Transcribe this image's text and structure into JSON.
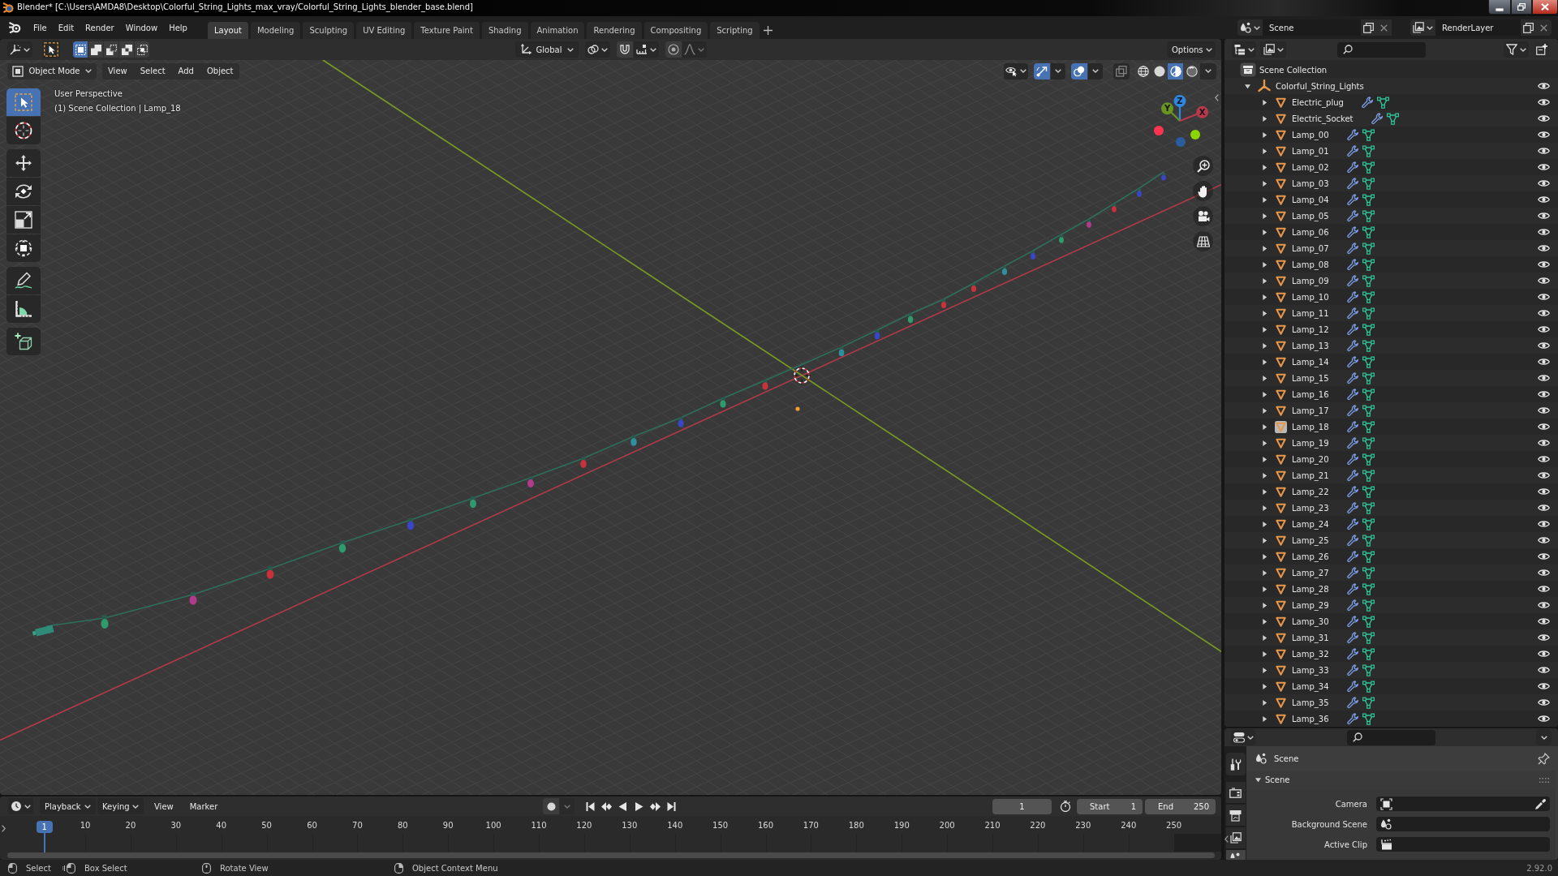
{
  "window": {
    "title": "Blender* [C:\\Users\\AMDA8\\Desktop\\Colorful_String_Lights_max_vray/Colorful_String_Lights_blender_base.blend]"
  },
  "top_bar": {
    "menus": [
      "File",
      "Edit",
      "Render",
      "Window",
      "Help"
    ],
    "workspaces": [
      {
        "label": "Layout",
        "selected": true
      },
      {
        "label": "Modeling",
        "selected": false
      },
      {
        "label": "Sculpting",
        "selected": false
      },
      {
        "label": "UV Editing",
        "selected": false
      },
      {
        "label": "Texture Paint",
        "selected": false
      },
      {
        "label": "Shading",
        "selected": false
      },
      {
        "label": "Animation",
        "selected": false
      },
      {
        "label": "Rendering",
        "selected": false
      },
      {
        "label": "Compositing",
        "selected": false
      },
      {
        "label": "Scripting",
        "selected": false
      }
    ],
    "scene": "Scene",
    "view_layer": "RenderLayer"
  },
  "viewport": {
    "tool_header": {
      "select_modes": [
        {
          "kind": "set",
          "selected": true
        },
        {
          "kind": "extend",
          "selected": false
        },
        {
          "kind": "subtract",
          "selected": false
        },
        {
          "kind": "difference",
          "selected": false
        },
        {
          "kind": "intersect",
          "selected": false
        }
      ],
      "orientation": "Global",
      "snap_on": false,
      "proportional_on": false,
      "options": "Options"
    },
    "header": {
      "mode": "Object Mode",
      "menus": [
        "View",
        "Select",
        "Add",
        "Object"
      ],
      "gizmos_on": true,
      "overlays_on": true,
      "xray_on": false,
      "shading": [
        {
          "kind": "wireframe",
          "selected": false
        },
        {
          "kind": "solid",
          "selected": false
        },
        {
          "kind": "material",
          "selected": true
        },
        {
          "kind": "rendered",
          "selected": false
        }
      ]
    },
    "tools": [
      {
        "kind": "select",
        "selected": true
      },
      {
        "kind": "cursor",
        "selected": false
      },
      {
        "kind": "move",
        "selected": false
      },
      {
        "kind": "rotate",
        "selected": false
      },
      {
        "kind": "scale",
        "selected": false
      },
      {
        "kind": "transform",
        "selected": false
      },
      {
        "kind": "annotate",
        "selected": false
      },
      {
        "kind": "measure",
        "selected": false
      },
      {
        "kind": "cube",
        "selected": false
      }
    ],
    "view_name": "User Perspective",
    "context": "(1) Scene Collection | Lamp_18",
    "axes": [
      {
        "kind": "z",
        "label": "Z"
      },
      {
        "kind": "y",
        "label": "Y"
      },
      {
        "kind": "x",
        "label": "X"
      }
    ]
  },
  "outliner": {
    "root": "Scene Collection",
    "objects": [
      {
        "name": "Colorful_String_Lights",
        "expanded": true,
        "visible": true,
        "children": [
          {
            "name": "Electric_plug",
            "expanded": false,
            "active": false,
            "visible": true
          },
          {
            "name": "Electric_Socket",
            "expanded": false,
            "active": false,
            "visible": true
          },
          {
            "name": "Lamp_00",
            "expanded": false,
            "active": false,
            "visible": true
          },
          {
            "name": "Lamp_01",
            "expanded": false,
            "active": false,
            "visible": true
          },
          {
            "name": "Lamp_02",
            "expanded": false,
            "active": false,
            "visible": true
          },
          {
            "name": "Lamp_03",
            "expanded": false,
            "active": false,
            "visible": true
          },
          {
            "name": "Lamp_04",
            "expanded": false,
            "active": false,
            "visible": true
          },
          {
            "name": "Lamp_05",
            "expanded": false,
            "active": false,
            "visible": true
          },
          {
            "name": "Lamp_06",
            "expanded": false,
            "active": false,
            "visible": true
          },
          {
            "name": "Lamp_07",
            "expanded": false,
            "active": false,
            "visible": true
          },
          {
            "name": "Lamp_08",
            "expanded": false,
            "active": false,
            "visible": true
          },
          {
            "name": "Lamp_09",
            "expanded": false,
            "active": false,
            "visible": true
          },
          {
            "name": "Lamp_10",
            "expanded": false,
            "active": false,
            "visible": true
          },
          {
            "name": "Lamp_11",
            "expanded": false,
            "active": false,
            "visible": true
          },
          {
            "name": "Lamp_12",
            "expanded": false,
            "active": false,
            "visible": true
          },
          {
            "name": "Lamp_13",
            "expanded": false,
            "active": false,
            "visible": true
          },
          {
            "name": "Lamp_14",
            "expanded": false,
            "active": false,
            "visible": true
          },
          {
            "name": "Lamp_15",
            "expanded": false,
            "active": false,
            "visible": true
          },
          {
            "name": "Lamp_16",
            "expanded": false,
            "active": false,
            "visible": true
          },
          {
            "name": "Lamp_17",
            "expanded": false,
            "active": false,
            "visible": true
          },
          {
            "name": "Lamp_18",
            "expanded": false,
            "active": true,
            "visible": true
          },
          {
            "name": "Lamp_19",
            "expanded": false,
            "active": false,
            "visible": true
          },
          {
            "name": "Lamp_20",
            "expanded": false,
            "active": false,
            "visible": true
          },
          {
            "name": "Lamp_21",
            "expanded": false,
            "active": false,
            "visible": true
          },
          {
            "name": "Lamp_22",
            "expanded": false,
            "active": false,
            "visible": true
          },
          {
            "name": "Lamp_23",
            "expanded": false,
            "active": false,
            "visible": true
          },
          {
            "name": "Lamp_24",
            "expanded": false,
            "active": false,
            "visible": true
          },
          {
            "name": "Lamp_25",
            "expanded": false,
            "active": false,
            "visible": true
          },
          {
            "name": "Lamp_26",
            "expanded": false,
            "active": false,
            "visible": true
          },
          {
            "name": "Lamp_27",
            "expanded": false,
            "active": false,
            "visible": true
          },
          {
            "name": "Lamp_28",
            "expanded": false,
            "active": false,
            "visible": true
          },
          {
            "name": "Lamp_29",
            "expanded": false,
            "active": false,
            "visible": true
          },
          {
            "name": "Lamp_30",
            "expanded": false,
            "active": false,
            "visible": true
          },
          {
            "name": "Lamp_31",
            "expanded": false,
            "active": false,
            "visible": true
          },
          {
            "name": "Lamp_32",
            "expanded": false,
            "active": false,
            "visible": true
          },
          {
            "name": "Lamp_33",
            "expanded": false,
            "active": false,
            "visible": true
          },
          {
            "name": "Lamp_34",
            "expanded": false,
            "active": false,
            "visible": true
          },
          {
            "name": "Lamp_35",
            "expanded": false,
            "active": false,
            "visible": true
          },
          {
            "name": "Lamp_36",
            "expanded": false,
            "active": false,
            "visible": true
          }
        ]
      }
    ]
  },
  "properties": {
    "tabs": [
      {
        "kind": "tool",
        "selected": false
      },
      {
        "kind": "render",
        "selected": false
      },
      {
        "kind": "output",
        "selected": false
      },
      {
        "kind": "view_layer",
        "selected": false
      },
      {
        "kind": "scene",
        "selected": true
      }
    ],
    "context": "Scene",
    "panel": {
      "title": "Scene",
      "expanded": true,
      "fields": [
        {
          "kind": "camera",
          "label": "Camera"
        },
        {
          "kind": "scene",
          "label": "Background Scene"
        },
        {
          "kind": "clip",
          "label": "Active Clip"
        }
      ]
    }
  },
  "timeline": {
    "menus": [
      {
        "kind": "dropdown",
        "label": "Playback"
      },
      {
        "kind": "dropdown",
        "label": "Keying"
      },
      {
        "kind": "menu",
        "label": "View"
      },
      {
        "kind": "menu",
        "label": "Marker"
      }
    ],
    "auto_keying": false,
    "current_frame": "1",
    "start_label": "Start",
    "start": "1",
    "end_label": "End",
    "end": "250",
    "frame_ticks": [
      "10",
      "20",
      "30",
      "40",
      "50",
      "60",
      "70",
      "80",
      "90",
      "100",
      "110",
      "120",
      "130",
      "140",
      "150",
      "160",
      "170",
      "180",
      "190",
      "200",
      "210",
      "220",
      "230",
      "240",
      "250"
    ],
    "playhead": "1"
  },
  "status_bar": {
    "hints": [
      {
        "kind": "left",
        "label": "Select"
      },
      {
        "kind": "drag",
        "label": "Box Select"
      },
      {
        "kind": "middle",
        "label": "Rotate View"
      },
      {
        "kind": "right",
        "label": "Object Context Menu"
      }
    ],
    "version": "2.92.0"
  }
}
